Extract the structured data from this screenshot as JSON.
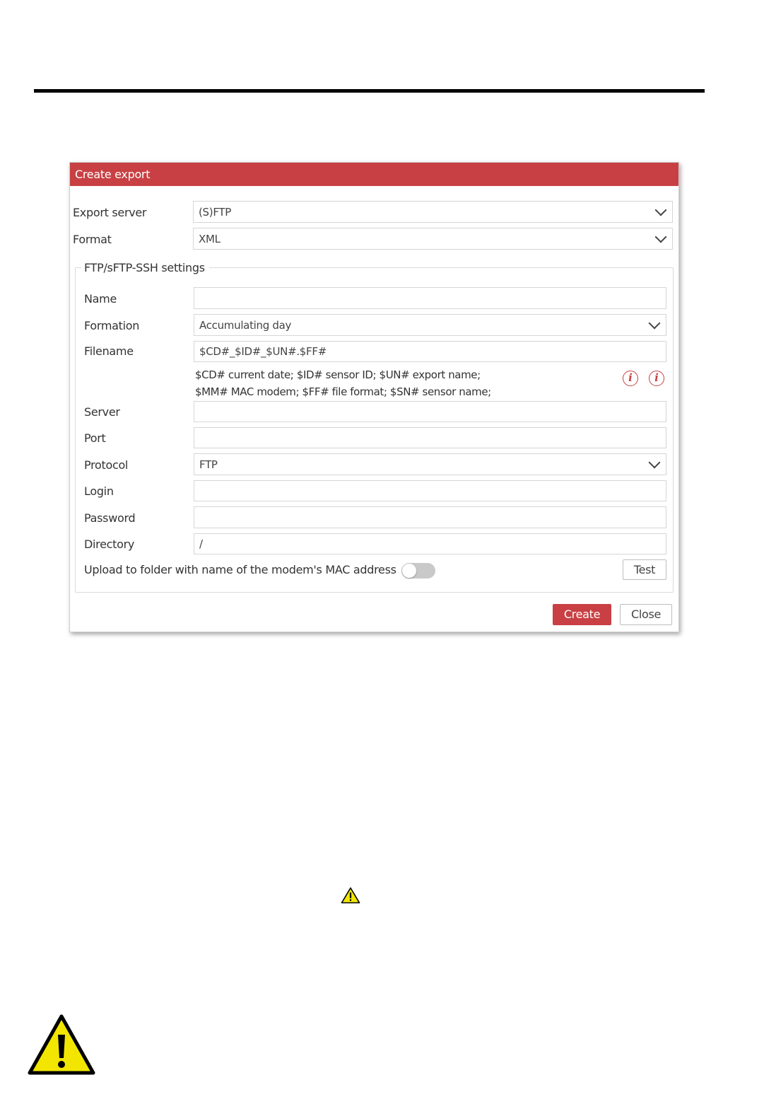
{
  "dialog": {
    "title": "Create export",
    "export_server": {
      "label": "Export server",
      "value": "(S)FTP"
    },
    "format": {
      "label": "Format",
      "value": "XML"
    },
    "settings": {
      "legend": "FTP/sFTP-SSH settings",
      "name": {
        "label": "Name",
        "value": ""
      },
      "formation": {
        "label": "Formation",
        "value": "Accumulating day"
      },
      "filename": {
        "label": "Filename",
        "value": "$CD#_$ID#_$UN#.$FF#"
      },
      "hint_line1": "$CD# current date; $ID# sensor ID; $UN# export name;",
      "hint_line2": "$MM# MAC modem; $FF# file format; $SN# sensor name;",
      "info_icon_glyph": "i",
      "server": {
        "label": "Server",
        "value": ""
      },
      "port": {
        "label": "Port",
        "value": ""
      },
      "protocol": {
        "label": "Protocol",
        "value": "FTP"
      },
      "login": {
        "label": "Login",
        "value": ""
      },
      "password": {
        "label": "Password",
        "value": ""
      },
      "directory": {
        "label": "Directory",
        "value": "/"
      },
      "upload_toggle": {
        "label": "Upload to folder with name of the modem's MAC address",
        "on": false
      },
      "test_label": "Test"
    },
    "create_label": "Create",
    "close_label": "Close"
  },
  "colors": {
    "accent": "#c84043",
    "warning_yellow": "#f2e600"
  },
  "icons": {
    "info": "info-icon",
    "warning": "warning-triangle-icon",
    "dropdown": "chevron-down-icon"
  }
}
